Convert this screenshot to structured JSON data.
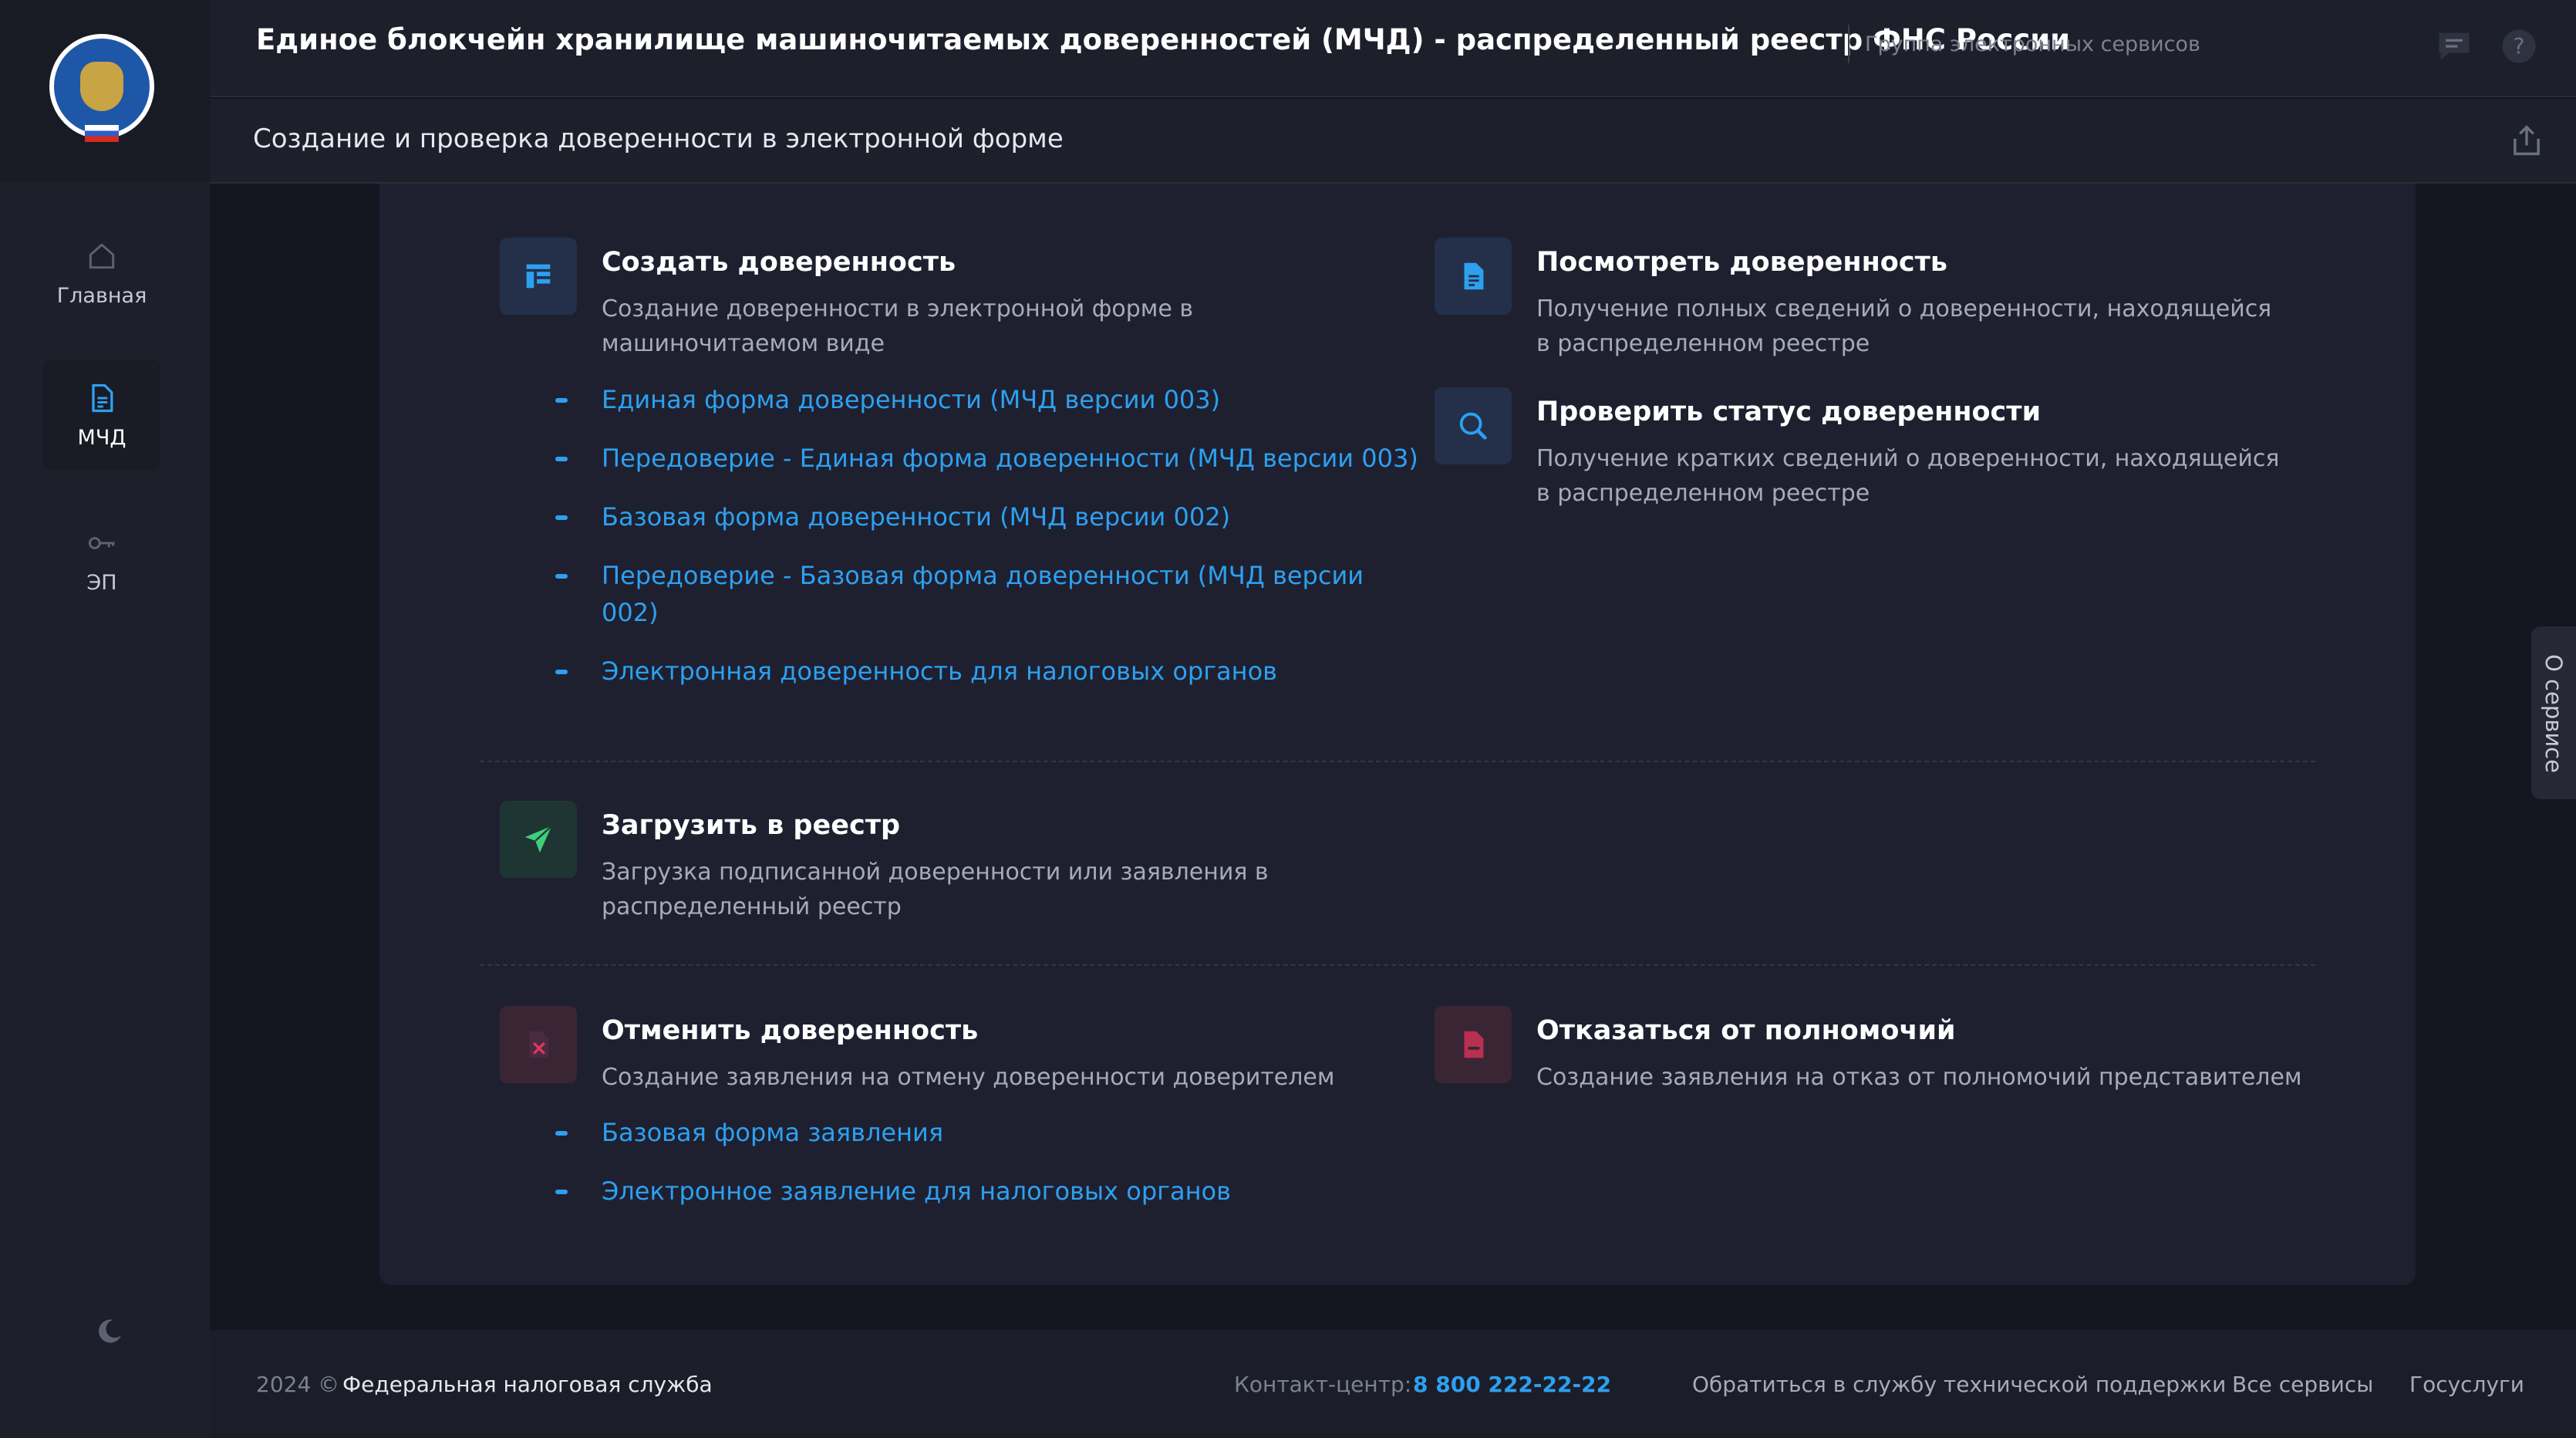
{
  "header": {
    "title": "Единое блокчейн хранилище машиночитаемых доверенностей (МЧД) - распределенный реестр ФНС России",
    "group_link": "Группа электронных сервисов",
    "subtitle": "Создание и проверка доверенности в электронной форме"
  },
  "sidebar": {
    "items": [
      {
        "label": "Главная",
        "icon": "home-icon",
        "active": false
      },
      {
        "label": "МЧД",
        "icon": "document-icon",
        "active": true
      },
      {
        "label": "ЭП",
        "icon": "key-icon",
        "active": false
      }
    ]
  },
  "side_tab": {
    "label": "О сервисе"
  },
  "cards": {
    "create": {
      "title": "Создать доверенность",
      "desc1": "Создание доверенности в электронной форме в",
      "desc2": "машиночитаемом виде",
      "links": [
        "Единая форма доверенности (МЧД версии 003)",
        "Передоверие - Единая форма доверенности (МЧД версии 003)",
        "Базовая форма доверенности (МЧД версии 002)",
        "Передоверие - Базовая форма доверенности (МЧД версии",
        "002)",
        "Электронная доверенность для налоговых органов"
      ]
    },
    "view": {
      "title": "Посмотреть доверенность",
      "desc1": "Получение полных сведений о доверенности, находящейся",
      "desc2": "в распределенном реестре"
    },
    "check": {
      "title": "Проверить статус доверенности",
      "desc1": "Получение кратких сведений о доверенности, находящейся",
      "desc2": "в распределенном реестре"
    },
    "upload": {
      "title": "Загрузить в реестр",
      "desc1": "Загрузка подписанной доверенности или заявления в",
      "desc2": "распределенный реестр"
    },
    "cancel": {
      "title": "Отменить доверенность",
      "desc1": "Создание заявления на отмену доверенности доверителем",
      "links": [
        "Базовая форма заявления",
        "Электронное заявление для налоговых органов"
      ]
    },
    "refuse": {
      "title": "Отказаться от полномочий",
      "desc1": "Создание заявления на отказ от полномочий представителем"
    }
  },
  "footer": {
    "year": "2024 ©",
    "org": "Федеральная налоговая служба",
    "contact_label": "Контакт-центр:",
    "phone": "8 800 222-22-22",
    "support": "Обратиться в службу технической поддержки",
    "all_services": "Все сервисы",
    "gosuslugi": "Госуслуги"
  },
  "colors": {
    "accent": "#2da0f0",
    "background": "#15161f",
    "panel": "#1e2030",
    "green": "#3ecf7a",
    "red": "#d93a5c"
  }
}
